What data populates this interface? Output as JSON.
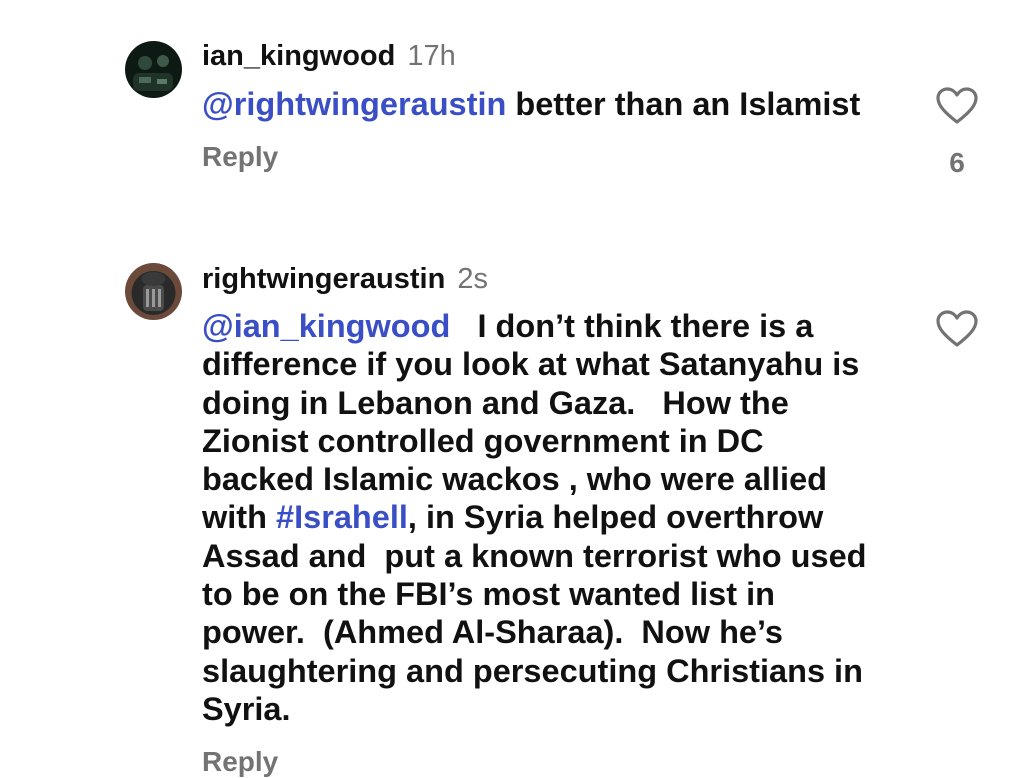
{
  "comments": [
    {
      "username": "ian_kingwood",
      "time": "17h",
      "mention": "@rightwingeraustin",
      "text": " better than an Islamist",
      "reply_label": "Reply",
      "like_count": "6",
      "like_icon": "heart-outline-icon"
    },
    {
      "username": "rightwingeraustin",
      "time": "2s",
      "mention": "@ian_kingwood",
      "text_part1": "   I don’t think there is a\ndifference if you look at what Satanyahu is\ndoing in Lebanon and Gaza.   How the\nZionist controlled government in DC\nbacked Islamic wackos , who were allied\nwith ",
      "hashtag": "#Israhell",
      "text_part2": ", in Syria helped overthrow\nAssad and  put a known terrorist who used\nto be on the FBI’s most wanted list in\npower.  (Ahmed Al-Sharaa).  Now he’s\nslaughtering and persecuting Christians in\nSyria.",
      "reply_label": "Reply",
      "like_icon": "heart-outline-icon"
    }
  ],
  "colors": {
    "mention": "#3a4fc5",
    "muted": "#737373",
    "text": "#111111"
  }
}
